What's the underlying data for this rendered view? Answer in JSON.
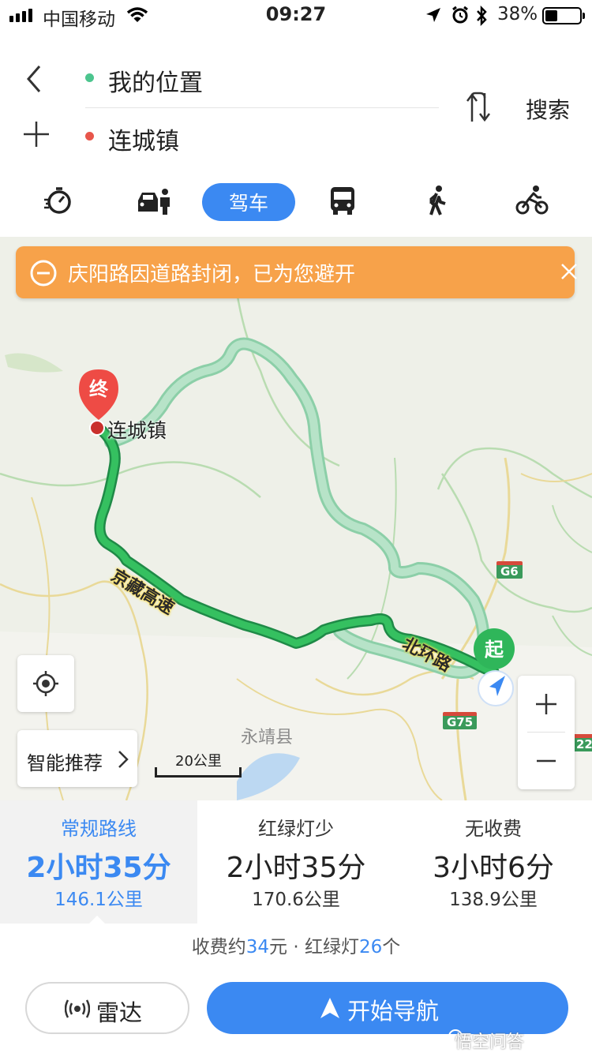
{
  "status_bar": {
    "carrier": "中国移动",
    "time": "09:27",
    "battery": "38%"
  },
  "route": {
    "from": "我的位置",
    "to": "连城镇",
    "search_label": "搜索"
  },
  "modes": {
    "active_label": "驾车",
    "items": [
      "taxi-timer-icon",
      "car-hailing-icon",
      "驾车",
      "bus-icon",
      "walk-icon",
      "bike-icon"
    ]
  },
  "map": {
    "notice": "庆阳路因道路封闭，已为您避开",
    "destination_marker": "终",
    "destination_label": "连城镇",
    "start_marker": "起",
    "road_names": [
      "京藏高速",
      "北环路"
    ],
    "place_labels": [
      "永靖县"
    ],
    "shields": [
      "G6",
      "G75",
      "22"
    ],
    "smart_recommend": "智能推荐",
    "scale": "20公里",
    "colors": {
      "route_main": "#2fb65a",
      "route_alt": "#a9dcbf",
      "accent": "#3b89f2",
      "notice": "#f7a24a"
    }
  },
  "options": [
    {
      "name": "常规路线",
      "duration": "2小时35分",
      "distance": "146.1公里",
      "selected": true
    },
    {
      "name": "红绿灯少",
      "duration": "2小时35分",
      "distance": "170.6公里",
      "selected": false
    },
    {
      "name": "无收费",
      "duration": "3小时6分",
      "distance": "138.9公里",
      "selected": false
    }
  ],
  "summary": {
    "toll_prefix": "收费约",
    "toll_value": "34",
    "toll_suffix": "元 · 红绿灯",
    "lights_value": "26",
    "lights_suffix": "个"
  },
  "actions": {
    "radar": "雷达",
    "start_nav": "开始导航"
  },
  "watermark": "悟空问答"
}
